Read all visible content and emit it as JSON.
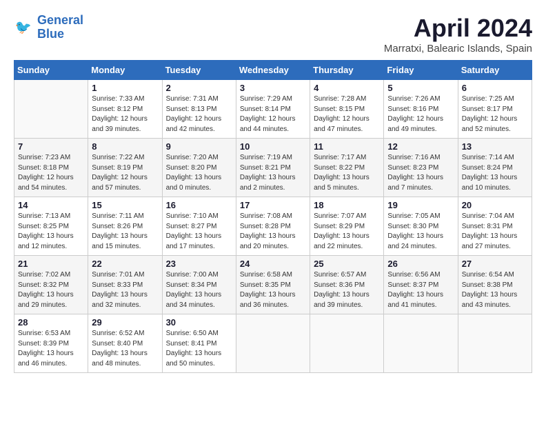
{
  "logo": {
    "line1": "General",
    "line2": "Blue"
  },
  "title": "April 2024",
  "location": "Marratxi, Balearic Islands, Spain",
  "headers": [
    "Sunday",
    "Monday",
    "Tuesday",
    "Wednesday",
    "Thursday",
    "Friday",
    "Saturday"
  ],
  "weeks": [
    [
      {
        "day": "",
        "info": ""
      },
      {
        "day": "1",
        "info": "Sunrise: 7:33 AM\nSunset: 8:12 PM\nDaylight: 12 hours\nand 39 minutes."
      },
      {
        "day": "2",
        "info": "Sunrise: 7:31 AM\nSunset: 8:13 PM\nDaylight: 12 hours\nand 42 minutes."
      },
      {
        "day": "3",
        "info": "Sunrise: 7:29 AM\nSunset: 8:14 PM\nDaylight: 12 hours\nand 44 minutes."
      },
      {
        "day": "4",
        "info": "Sunrise: 7:28 AM\nSunset: 8:15 PM\nDaylight: 12 hours\nand 47 minutes."
      },
      {
        "day": "5",
        "info": "Sunrise: 7:26 AM\nSunset: 8:16 PM\nDaylight: 12 hours\nand 49 minutes."
      },
      {
        "day": "6",
        "info": "Sunrise: 7:25 AM\nSunset: 8:17 PM\nDaylight: 12 hours\nand 52 minutes."
      }
    ],
    [
      {
        "day": "7",
        "info": "Sunrise: 7:23 AM\nSunset: 8:18 PM\nDaylight: 12 hours\nand 54 minutes."
      },
      {
        "day": "8",
        "info": "Sunrise: 7:22 AM\nSunset: 8:19 PM\nDaylight: 12 hours\nand 57 minutes."
      },
      {
        "day": "9",
        "info": "Sunrise: 7:20 AM\nSunset: 8:20 PM\nDaylight: 13 hours\nand 0 minutes."
      },
      {
        "day": "10",
        "info": "Sunrise: 7:19 AM\nSunset: 8:21 PM\nDaylight: 13 hours\nand 2 minutes."
      },
      {
        "day": "11",
        "info": "Sunrise: 7:17 AM\nSunset: 8:22 PM\nDaylight: 13 hours\nand 5 minutes."
      },
      {
        "day": "12",
        "info": "Sunrise: 7:16 AM\nSunset: 8:23 PM\nDaylight: 13 hours\nand 7 minutes."
      },
      {
        "day": "13",
        "info": "Sunrise: 7:14 AM\nSunset: 8:24 PM\nDaylight: 13 hours\nand 10 minutes."
      }
    ],
    [
      {
        "day": "14",
        "info": "Sunrise: 7:13 AM\nSunset: 8:25 PM\nDaylight: 13 hours\nand 12 minutes."
      },
      {
        "day": "15",
        "info": "Sunrise: 7:11 AM\nSunset: 8:26 PM\nDaylight: 13 hours\nand 15 minutes."
      },
      {
        "day": "16",
        "info": "Sunrise: 7:10 AM\nSunset: 8:27 PM\nDaylight: 13 hours\nand 17 minutes."
      },
      {
        "day": "17",
        "info": "Sunrise: 7:08 AM\nSunset: 8:28 PM\nDaylight: 13 hours\nand 20 minutes."
      },
      {
        "day": "18",
        "info": "Sunrise: 7:07 AM\nSunset: 8:29 PM\nDaylight: 13 hours\nand 22 minutes."
      },
      {
        "day": "19",
        "info": "Sunrise: 7:05 AM\nSunset: 8:30 PM\nDaylight: 13 hours\nand 24 minutes."
      },
      {
        "day": "20",
        "info": "Sunrise: 7:04 AM\nSunset: 8:31 PM\nDaylight: 13 hours\nand 27 minutes."
      }
    ],
    [
      {
        "day": "21",
        "info": "Sunrise: 7:02 AM\nSunset: 8:32 PM\nDaylight: 13 hours\nand 29 minutes."
      },
      {
        "day": "22",
        "info": "Sunrise: 7:01 AM\nSunset: 8:33 PM\nDaylight: 13 hours\nand 32 minutes."
      },
      {
        "day": "23",
        "info": "Sunrise: 7:00 AM\nSunset: 8:34 PM\nDaylight: 13 hours\nand 34 minutes."
      },
      {
        "day": "24",
        "info": "Sunrise: 6:58 AM\nSunset: 8:35 PM\nDaylight: 13 hours\nand 36 minutes."
      },
      {
        "day": "25",
        "info": "Sunrise: 6:57 AM\nSunset: 8:36 PM\nDaylight: 13 hours\nand 39 minutes."
      },
      {
        "day": "26",
        "info": "Sunrise: 6:56 AM\nSunset: 8:37 PM\nDaylight: 13 hours\nand 41 minutes."
      },
      {
        "day": "27",
        "info": "Sunrise: 6:54 AM\nSunset: 8:38 PM\nDaylight: 13 hours\nand 43 minutes."
      }
    ],
    [
      {
        "day": "28",
        "info": "Sunrise: 6:53 AM\nSunset: 8:39 PM\nDaylight: 13 hours\nand 46 minutes."
      },
      {
        "day": "29",
        "info": "Sunrise: 6:52 AM\nSunset: 8:40 PM\nDaylight: 13 hours\nand 48 minutes."
      },
      {
        "day": "30",
        "info": "Sunrise: 6:50 AM\nSunset: 8:41 PM\nDaylight: 13 hours\nand 50 minutes."
      },
      {
        "day": "",
        "info": ""
      },
      {
        "day": "",
        "info": ""
      },
      {
        "day": "",
        "info": ""
      },
      {
        "day": "",
        "info": ""
      }
    ]
  ]
}
